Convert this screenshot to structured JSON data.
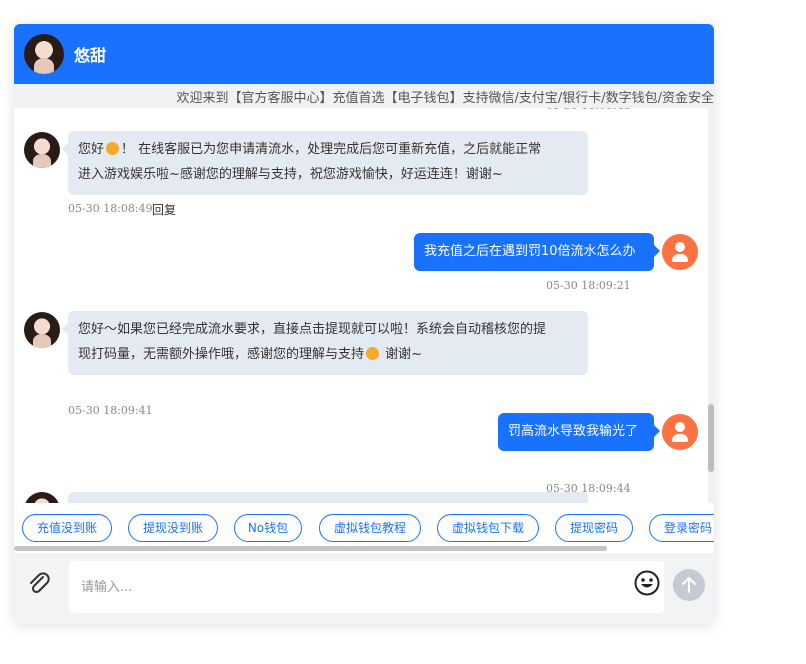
{
  "header": {
    "title": "悠甜"
  },
  "marquee": {
    "text": "欢迎来到【官方客服中心】充值首选【电子钱包】支持微信/支付宝/银行卡/数字钱包/资金安全"
  },
  "messages": [
    {
      "side": "in",
      "text_a": "您好",
      "text_b": "！ 在线客服已为您申请清流水，处理完成后您可重新充值，之后就能正常",
      "text_c": "进入游戏娱乐啦~感谢您的理解与支持，祝您游戏愉快，好运连连！谢谢~",
      "time": "05-30 18:08:49",
      "reply": "回复"
    },
    {
      "side": "out",
      "text": "我充值之后在遇到罚10倍流水怎么办",
      "time": "05-30 18:09:21"
    },
    {
      "side": "in",
      "text_a": "您好～如果您已经完成流水要求，直接点击提现就可以啦！系统会自动稽核您的提",
      "text_b": "现打码量，无需额外操作哦，感谢您的理解与支持",
      "text_c": " 谢谢~",
      "time": "05-30 18:09:41"
    },
    {
      "side": "out",
      "text": "罚高流水导致我输光了",
      "time": "05-30 18:09:44"
    }
  ],
  "quick_replies": [
    "充值没到账",
    "提现没到账",
    "No钱包",
    "虚拟钱包教程",
    "虚拟钱包下载",
    "提现密码",
    "登录密码"
  ],
  "input": {
    "placeholder": "请输入..."
  },
  "colors": {
    "primary": "#1872fe",
    "user_avatar": "#fd7241",
    "bubble_in": "#e4eaf2"
  },
  "icons": {
    "attach": "paperclip-icon",
    "emoji": "smiley-icon",
    "send": "arrow-up-icon",
    "user": "user-icon"
  }
}
